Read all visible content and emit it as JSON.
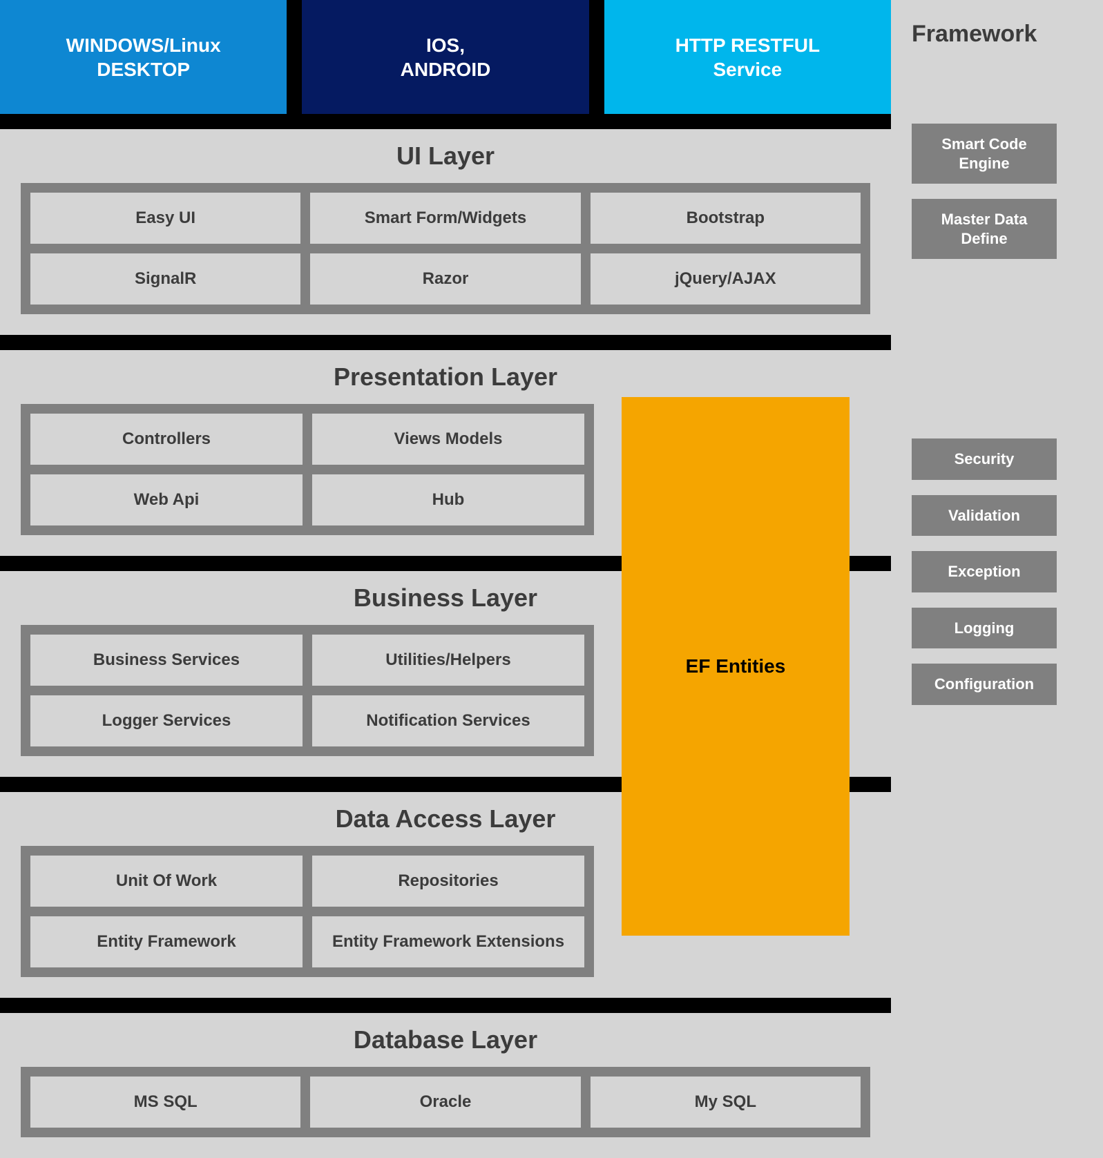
{
  "platforms": {
    "desktop": "WINDOWS/Linux\nDESKTOP",
    "mobile": "IOS,\nANDROID",
    "http": "HTTP RESTFUL\nService"
  },
  "layers": {
    "ui": {
      "title": "UI Layer",
      "cells": [
        "Easy UI",
        "Smart Form/Widgets",
        "Bootstrap",
        "SignalR",
        "Razor",
        "jQuery/AJAX"
      ]
    },
    "presentation": {
      "title": "Presentation Layer",
      "cells": [
        "Controllers",
        "Views Models",
        "Web Api",
        "Hub"
      ]
    },
    "business": {
      "title": "Business Layer",
      "cells": [
        "Business Services",
        "Utilities/Helpers",
        "Logger Services",
        "Notification   Services"
      ]
    },
    "data_access": {
      "title": "Data Access Layer",
      "cells": [
        "Unit Of Work",
        "Repositories",
        "Entity Framework",
        "Entity Framework Extensions"
      ]
    },
    "database": {
      "title": "Database Layer",
      "cells": [
        "MS SQL",
        "Oracle",
        "My SQL"
      ]
    }
  },
  "ef_entities": "EF Entities",
  "framework": {
    "title": "Framework",
    "top": [
      "Smart Code\nEngine",
      "Master Data\nDefine"
    ],
    "bottom": [
      "Security",
      "Validation",
      "Exception",
      "Logging",
      "Configuration"
    ]
  }
}
